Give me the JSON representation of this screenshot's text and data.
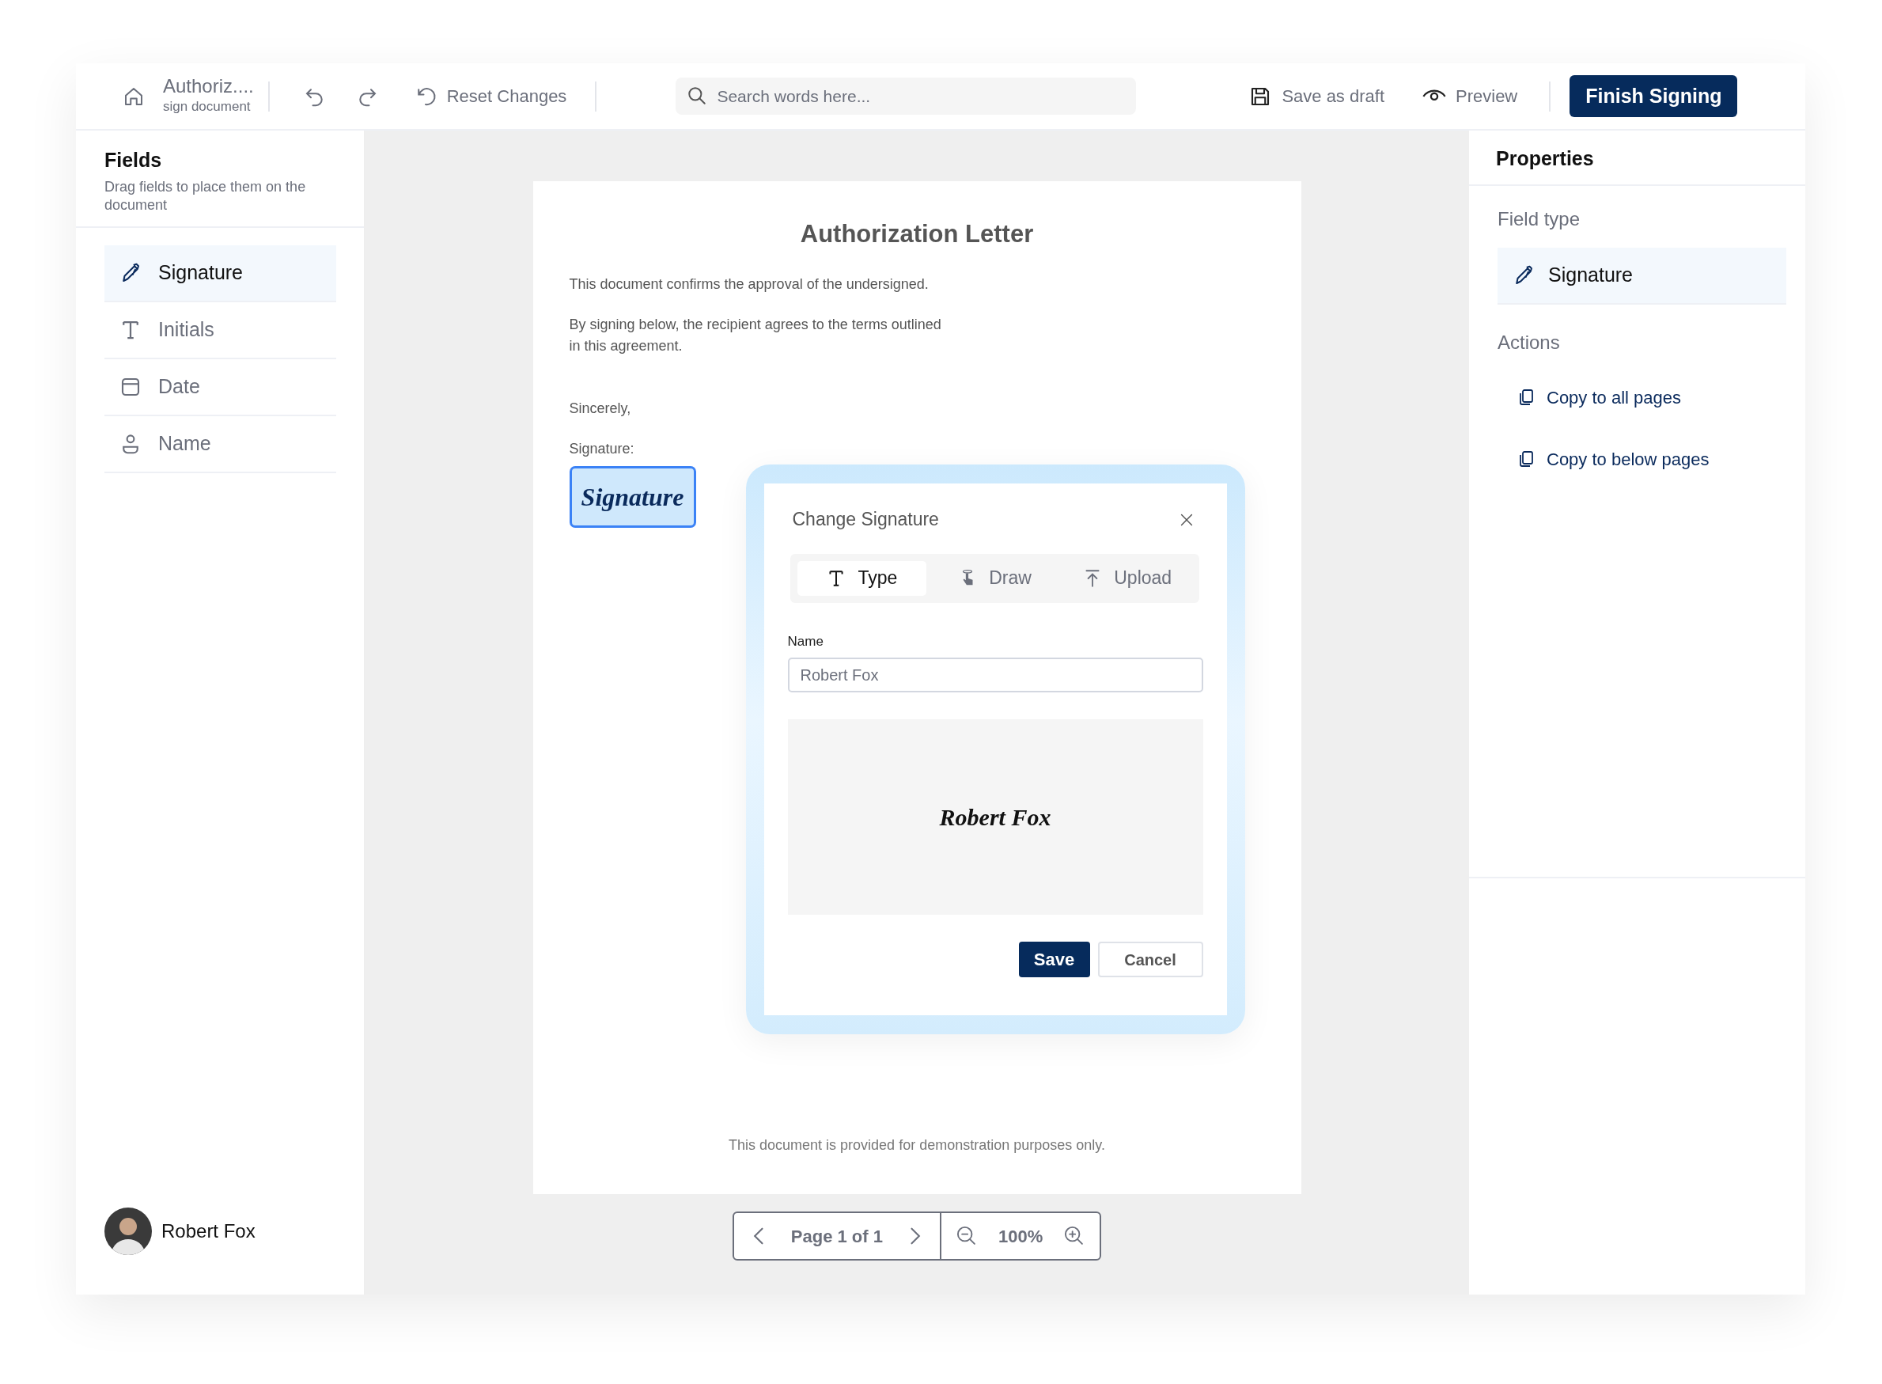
{
  "header": {
    "doc_title": "Authoriz....",
    "doc_subtitle": "sign document",
    "reset_label": "Reset Changes",
    "search": {
      "placeholder": "Search words here..."
    },
    "save_draft": "Save as draft",
    "preview": "Preview",
    "finish": "Finish Signing"
  },
  "fields_panel": {
    "title": "Fields",
    "hint": "Drag fields to place them on the document",
    "items": [
      {
        "label": "Signature",
        "kind": "pen",
        "selected": true
      },
      {
        "label": "Initials",
        "kind": "text",
        "selected": false
      },
      {
        "label": "Date",
        "kind": "calendar",
        "selected": false
      },
      {
        "label": "Name",
        "kind": "person",
        "selected": false
      }
    ]
  },
  "user": {
    "name": "Robert Fox"
  },
  "document": {
    "title": "Authorization Letter",
    "paragraphs": [
      "This document confirms the approval of the undersigned.",
      "By signing below, the recipient agrees to the terms outlined in this agreement."
    ],
    "closing": "Sincerely,",
    "signature_label": "Signature:",
    "signature_field": "Signature",
    "footer": "This document is provided for demonstration purposes only."
  },
  "pager": {
    "page": "Page 1 of 1",
    "zoom": "100%"
  },
  "properties": {
    "title": "Properties",
    "field_type_label": "Field type",
    "field_type": {
      "label": "Signature",
      "kind": "pen"
    },
    "actions_label": "Actions",
    "actions": [
      "Copy to all pages",
      "Copy to below pages"
    ]
  },
  "dialog": {
    "title": "Change Signature",
    "tabs": [
      {
        "label": "Type",
        "kind": "text",
        "selected": true
      },
      {
        "label": "Draw",
        "kind": "hand",
        "selected": false
      },
      {
        "label": "Upload",
        "kind": "upload",
        "selected": false
      }
    ],
    "name_label": "Name",
    "name_value": "Robert Fox",
    "preview": "Robert Fox",
    "buttons": [
      {
        "label": "Save",
        "kind": "primary"
      },
      {
        "label": "Cancel",
        "kind": "secondary"
      }
    ]
  }
}
